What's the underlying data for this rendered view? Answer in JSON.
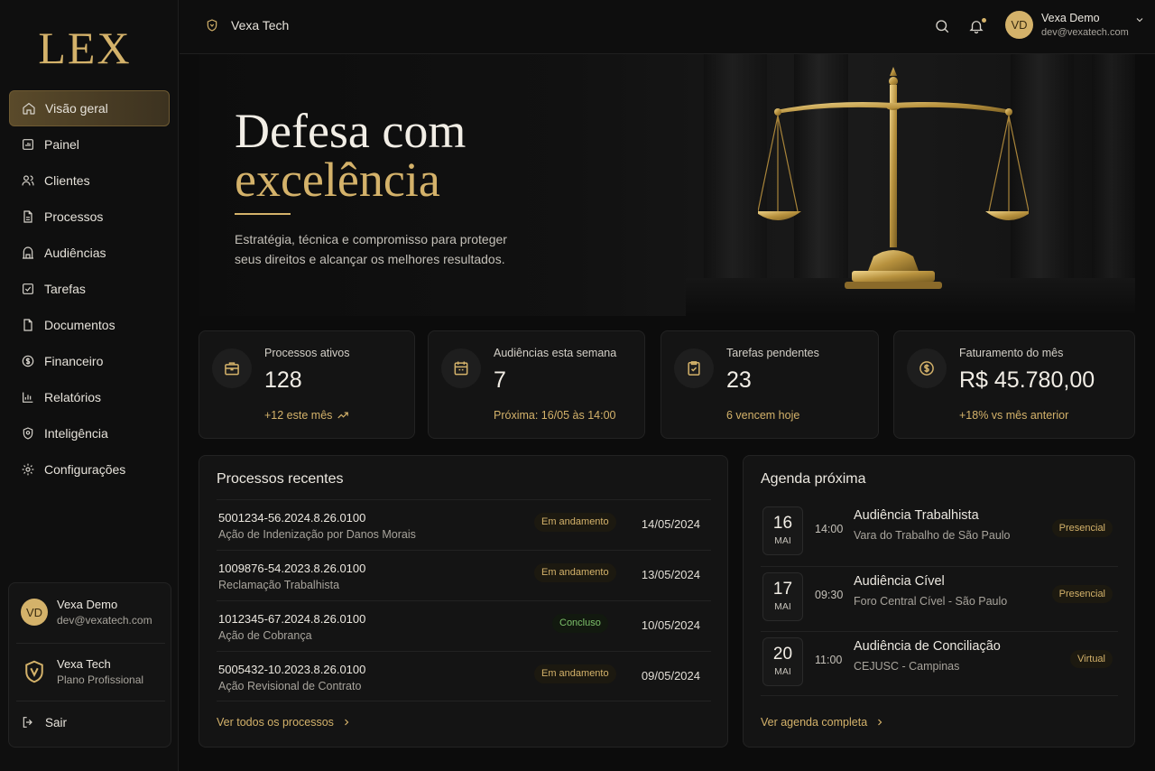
{
  "colors": {
    "accent": "#d4b26a",
    "success": "#7cc06a",
    "background": "#0c0c0c"
  },
  "sidebar": {
    "logo": "LEX",
    "items": [
      {
        "label": "Visão geral",
        "icon": "home-icon",
        "active": true
      },
      {
        "label": "Painel",
        "icon": "dashboard-icon"
      },
      {
        "label": "Clientes",
        "icon": "users-icon"
      },
      {
        "label": "Processos",
        "icon": "file-icon"
      },
      {
        "label": "Audiências",
        "icon": "gavel-icon"
      },
      {
        "label": "Tarefas",
        "icon": "checkbox-icon"
      },
      {
        "label": "Documentos",
        "icon": "document-icon"
      },
      {
        "label": "Financeiro",
        "icon": "finance-icon"
      },
      {
        "label": "Relatórios",
        "icon": "chart-icon"
      },
      {
        "label": "Inteligência",
        "icon": "intelligence-icon"
      },
      {
        "label": "Configurações",
        "icon": "gear-icon"
      }
    ],
    "user": {
      "initials": "VD",
      "name": "Vexa Demo",
      "email": "dev@vexatech.com"
    },
    "org": {
      "name": "Vexa Tech",
      "plan": "Plano Profissional"
    },
    "logout": "Sair"
  },
  "topbar": {
    "org_name": "Vexa Tech",
    "user": {
      "initials": "VD",
      "name": "Vexa Demo",
      "email": "dev@vexatech.com"
    }
  },
  "hero": {
    "title_line1": "Defesa com",
    "title_line2": "excelência",
    "subtitle": "Estratégia, técnica e compromisso para proteger seus direitos e alcançar os melhores resultados."
  },
  "stats": [
    {
      "label": "Processos ativos",
      "value": "128",
      "foot": "+12 este mês",
      "icon": "briefcase-icon"
    },
    {
      "label": "Audiências esta semana",
      "value": "7",
      "foot": "Próxima: 16/05 às 14:00",
      "icon": "calendar-icon"
    },
    {
      "label": "Tarefas pendentes",
      "value": "23",
      "foot": "6 vencem hoje",
      "icon": "clipboard-check-icon"
    },
    {
      "label": "Faturamento do mês",
      "value": "R$ 45.780,00",
      "foot": "+18% vs mês anterior",
      "icon": "dollar-coin-icon"
    }
  ],
  "processes": {
    "title": "Processos recentes",
    "rows": [
      {
        "number": "5001234-56.2024.8.26.0100",
        "description": "Ação de Indenização por Danos Morais",
        "status": "Em andamento",
        "date": "14/05/2024"
      },
      {
        "number": "1009876-54.2023.8.26.0100",
        "description": "Reclamação Trabalhista",
        "status": "Em andamento",
        "date": "13/05/2024"
      },
      {
        "number": "1012345-67.2024.8.26.0100",
        "description": "Ação de Cobrança",
        "status": "Concluso",
        "date": "10/05/2024"
      },
      {
        "number": "5005432-10.2023.8.26.0100",
        "description": "Ação Revisional de Contrato",
        "status": "Em andamento",
        "date": "09/05/2024"
      }
    ],
    "link": "Ver todos os processos"
  },
  "agenda": {
    "title": "Agenda próxima",
    "items": [
      {
        "day": "16",
        "month": "MAI",
        "time": "14:00",
        "title": "Audiência Trabalhista",
        "location": "Vara do Trabalho de São Paulo",
        "type": "Presencial"
      },
      {
        "day": "17",
        "month": "MAI",
        "time": "09:30",
        "title": "Audiência Cível",
        "location": "Foro Central Cível - São Paulo",
        "type": "Presencial"
      },
      {
        "day": "20",
        "month": "MAI",
        "time": "11:00",
        "title": "Audiência de Conciliação",
        "location": "CEJUSC - Campinas",
        "type": "Virtual"
      }
    ],
    "link": "Ver agenda completa"
  }
}
